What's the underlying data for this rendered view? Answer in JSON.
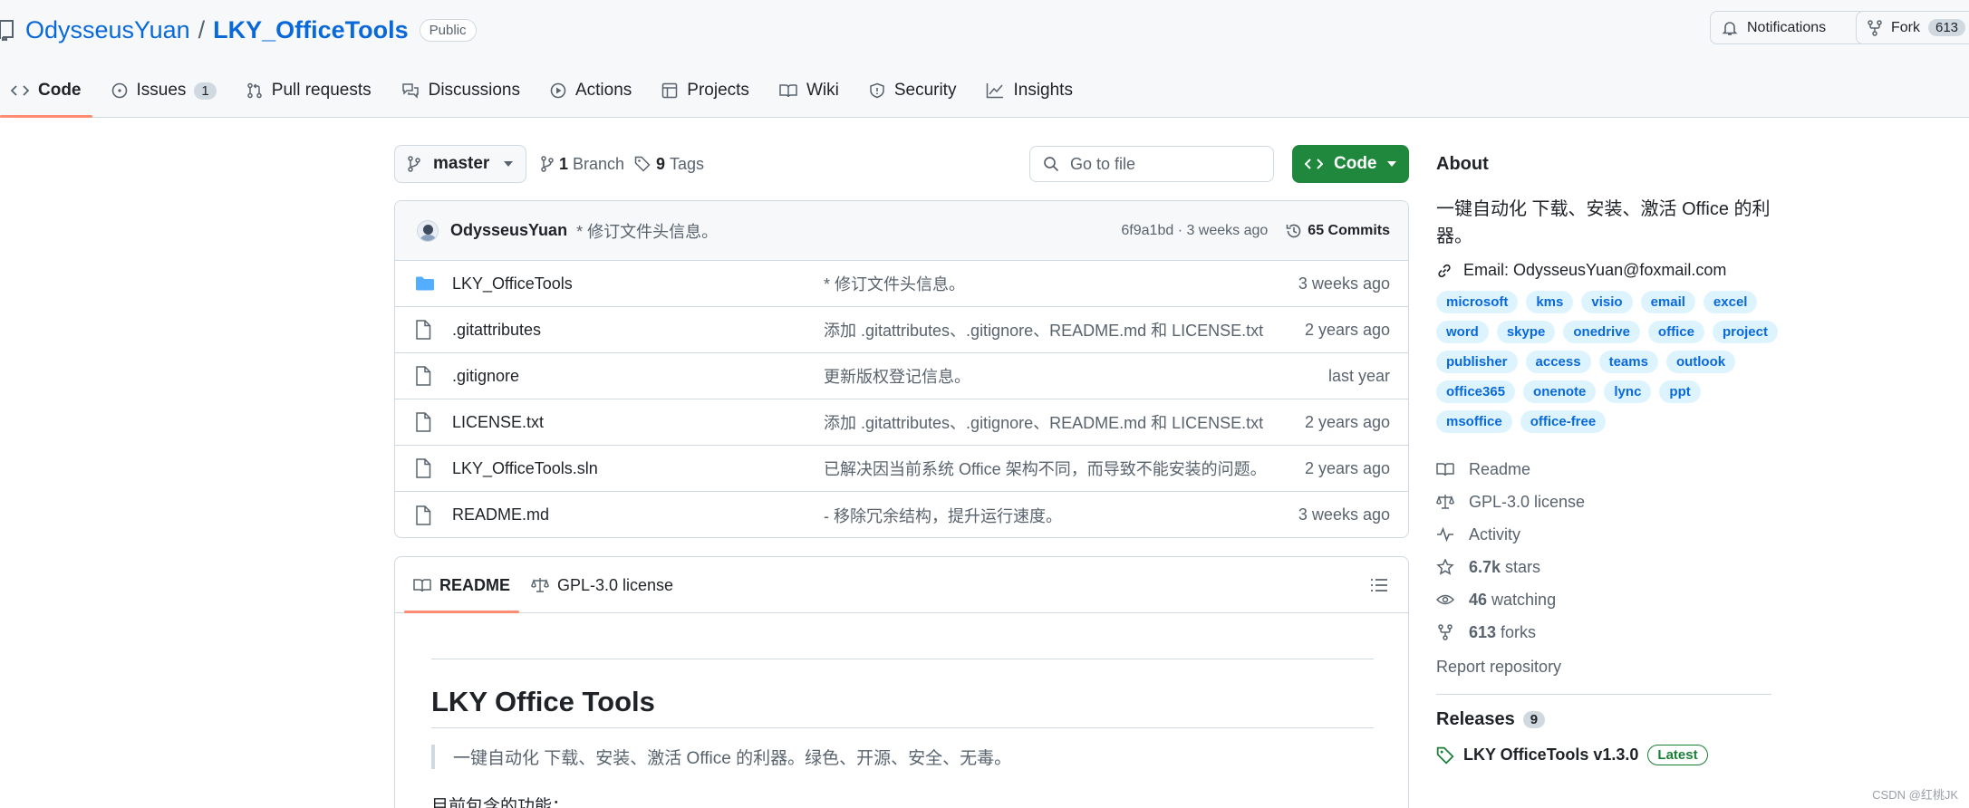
{
  "repo": {
    "owner": "OdysseusYuan",
    "separator": "/",
    "name": "LKY_OfficeTools",
    "visibility": "Public"
  },
  "header_actions": {
    "notifications_label": "Notifications",
    "fork_label": "Fork",
    "fork_count": "613"
  },
  "nav": {
    "tabs": [
      {
        "label": "Code",
        "icon": "code-icon",
        "active": true
      },
      {
        "label": "Issues",
        "icon": "issue-icon",
        "count": "1"
      },
      {
        "label": "Pull requests",
        "icon": "pull-request-icon"
      },
      {
        "label": "Discussions",
        "icon": "discussions-icon"
      },
      {
        "label": "Actions",
        "icon": "actions-play-icon"
      },
      {
        "label": "Projects",
        "icon": "projects-table-icon"
      },
      {
        "label": "Wiki",
        "icon": "book-icon"
      },
      {
        "label": "Security",
        "icon": "shield-icon"
      },
      {
        "label": "Insights",
        "icon": "graph-icon"
      }
    ]
  },
  "toolbar": {
    "branch": "master",
    "branch_count": "1",
    "branch_label": "Branch",
    "tag_count": "9",
    "tag_label": "Tags",
    "search_placeholder": "Go to file",
    "code_button": "Code"
  },
  "latest_commit": {
    "author": "OdysseusYuan",
    "message": "* 修订文件头信息。",
    "hash_time": "6f9a1bd · 3 weeks ago",
    "commits_label": "65 Commits"
  },
  "files": [
    {
      "name": "LKY_OfficeTools",
      "type": "folder",
      "message": "* 修订文件头信息。",
      "time": "3 weeks ago"
    },
    {
      "name": ".gitattributes",
      "type": "file",
      "message": "添加 .gitattributes、.gitignore、README.md 和 LICENSE.txt",
      "time": "2 years ago"
    },
    {
      "name": ".gitignore",
      "type": "file",
      "message": "更新版权登记信息。",
      "time": "last year"
    },
    {
      "name": "LICENSE.txt",
      "type": "file",
      "message": "添加 .gitattributes、.gitignore、README.md 和 LICENSE.txt",
      "time": "2 years ago"
    },
    {
      "name": "LKY_OfficeTools.sln",
      "type": "file",
      "message": "已解决因当前系统 Office 架构不同，而导致不能安装的问题。",
      "time": "2 years ago"
    },
    {
      "name": "README.md",
      "type": "file",
      "message": "- 移除冗余结构，提升运行速度。",
      "time": "3 weeks ago"
    }
  ],
  "readme": {
    "tab_readme": "README",
    "tab_license": "GPL-3.0 license",
    "heading": "LKY Office Tools",
    "quote": "一键自动化 下载、安装、激活 Office 的利器。绿色、开源、安全、无毒。",
    "paragraph": "目前包含的功能："
  },
  "about": {
    "title": "About",
    "description": "一键自动化 下载、安装、激活 Office 的利器。",
    "email": "Email: OdysseusYuan@foxmail.com",
    "topics": [
      "microsoft",
      "kms",
      "visio",
      "email",
      "excel",
      "word",
      "skype",
      "onedrive",
      "office",
      "project",
      "publisher",
      "access",
      "teams",
      "outlook",
      "office365",
      "onenote",
      "lync",
      "ppt",
      "msoffice",
      "office-free"
    ],
    "readme_link": "Readme",
    "license_link": "GPL-3.0 license",
    "activity_link": "Activity",
    "stars_count": "6.7k",
    "stars_label": "stars",
    "watching_count": "46",
    "watching_label": "watching",
    "forks_count": "613",
    "forks_label": "forks",
    "report": "Report repository"
  },
  "releases": {
    "title": "Releases",
    "count": "9",
    "latest_name": "LKY OfficeTools v1.3.0",
    "latest_badge": "Latest"
  },
  "watermark": "CSDN @红桃JK",
  "colors": {
    "link": "#0969da",
    "code_button": "#1f883d",
    "active_tab_underline": "#fd8c73",
    "folder": "#54aeff",
    "topic_bg": "#ddf4ff"
  }
}
